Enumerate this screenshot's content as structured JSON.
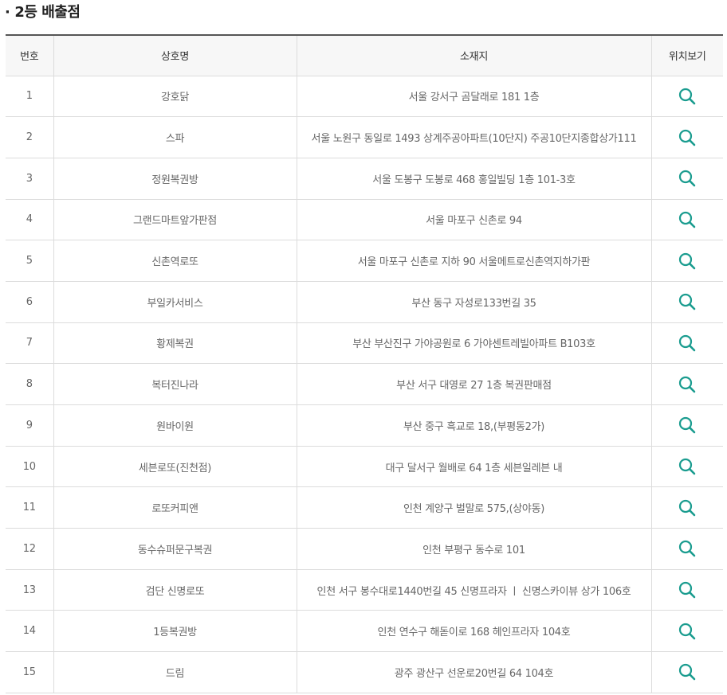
{
  "section": {
    "bullet": "·",
    "title": "2등 배출점"
  },
  "table": {
    "columns": [
      "번호",
      "상호명",
      "소재지",
      "위치보기"
    ],
    "rows": [
      {
        "no": "1",
        "name": "강호닭",
        "address": "서울 강서구 곰달래로 181 1층"
      },
      {
        "no": "2",
        "name": "스파",
        "address": "서울 노원구 동일로 1493 상계주공아파트(10단지) 주공10단지종합상가111"
      },
      {
        "no": "3",
        "name": "정원복권방",
        "address": "서울 도봉구 도봉로 468 홍일빌딩 1층 101-3호"
      },
      {
        "no": "4",
        "name": "그랜드마트앞가판점",
        "address": "서울 마포구 신촌로 94"
      },
      {
        "no": "5",
        "name": "신촌역로또",
        "address": "서울 마포구 신촌로 지하 90 서울메트로신촌역지하가판"
      },
      {
        "no": "6",
        "name": "부일카서비스",
        "address": "부산 동구 자성로133번길 35"
      },
      {
        "no": "7",
        "name": "황제복권",
        "address": "부산 부산진구 가야공원로 6 가야센트레빌아파트 B103호"
      },
      {
        "no": "8",
        "name": "복터진나라",
        "address": "부산 서구 대영로 27 1층 복권판매점"
      },
      {
        "no": "9",
        "name": "원바이원",
        "address": "부산 중구 흑교로 18,(부평동2가)"
      },
      {
        "no": "10",
        "name": "세븐로또(진천점)",
        "address": "대구 달서구 월배로 64 1층 세븐일레븐 내"
      },
      {
        "no": "11",
        "name": "로또커피앤",
        "address": "인천 계양구 벌말로 575,(상야동)"
      },
      {
        "no": "12",
        "name": "동수슈퍼문구복권",
        "address": "인천 부평구 동수로 101"
      },
      {
        "no": "13",
        "name": "검단 신명로또",
        "address": "인천 서구 봉수대로1440번길 45 신명프라자 ㅣ 신명스카이뷰 상가 106호"
      },
      {
        "no": "14",
        "name": "1등복권방",
        "address": "인천 연수구 해돋이로 168 헤인프라자 104호"
      },
      {
        "no": "15",
        "name": "드림",
        "address": "광주 광산구 선운로20번길 64 104호"
      }
    ],
    "location_icon": "search-icon"
  },
  "colors": {
    "icon": "#1a9c8f",
    "header_bg": "#f7f7f7",
    "border": "#dcdcdc",
    "header_top_border": "#555555"
  }
}
